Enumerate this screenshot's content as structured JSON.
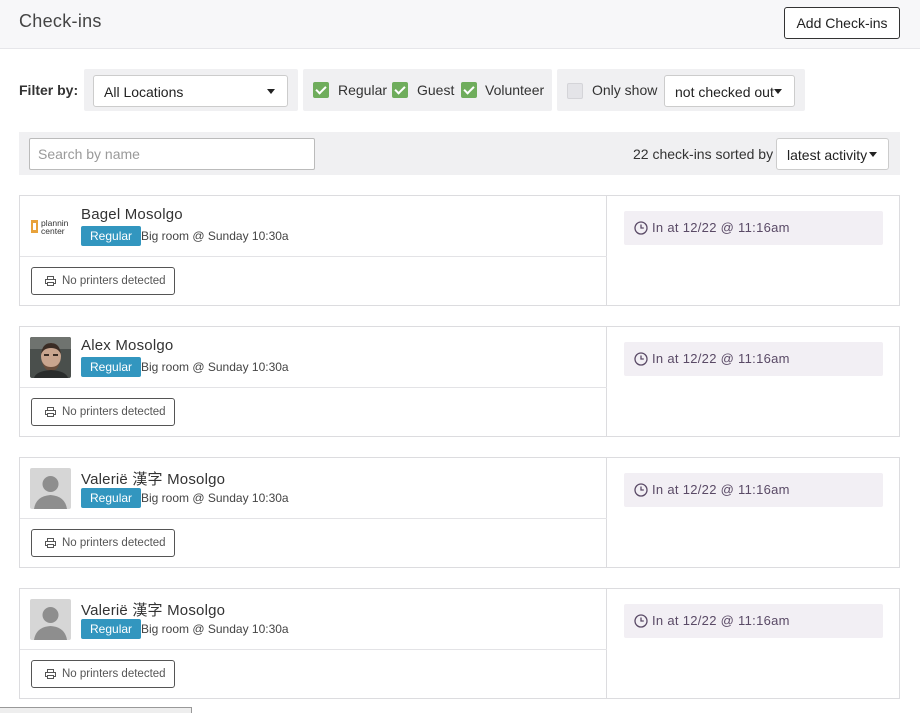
{
  "header": {
    "title": "Check-ins",
    "add_button": "Add Check-ins"
  },
  "filters": {
    "label": "Filter by:",
    "location": "All Locations",
    "kinds": [
      {
        "label": "Regular",
        "checked": true
      },
      {
        "label": "Guest",
        "checked": true
      },
      {
        "label": "Volunteer",
        "checked": true
      }
    ],
    "only_show": {
      "label": "Only show",
      "checked": false,
      "value": "not checked out"
    }
  },
  "search": {
    "placeholder": "Search by name",
    "count_text": "22 check-ins sorted by",
    "sort": "latest activity"
  },
  "checkins": [
    {
      "name": "Bagel Mosolgo",
      "avatar": "planning-center-logo",
      "logo_line1": "plannin",
      "logo_line2": "center",
      "kind": "Regular",
      "location": "Big room @ Sunday 10:30a",
      "printer": "No printers detected",
      "status": "In at 12/22 @ 11:16am"
    },
    {
      "name": "Alex Mosolgo",
      "avatar": "photo",
      "kind": "Regular",
      "location": "Big room @ Sunday 10:30a",
      "printer": "No printers detected",
      "status": "In at 12/22 @ 11:16am"
    },
    {
      "name": "Valerië 漢字 Mosolgo",
      "avatar": "default-silhouette",
      "kind": "Regular",
      "location": "Big room @ Sunday 10:30a",
      "printer": "No printers detected",
      "status": "In at 12/22 @ 11:16am"
    },
    {
      "name": "Valerië 漢字 Mosolgo",
      "avatar": "default-silhouette",
      "kind": "Regular",
      "location": "Big room @ Sunday 10:30a",
      "printer": "No printers detected",
      "status": "In at 12/22 @ 11:16am"
    }
  ],
  "colors": {
    "badge": "#3296bf",
    "checkbox_on": "#6fad5c",
    "status_bg": "#f2eff4"
  }
}
